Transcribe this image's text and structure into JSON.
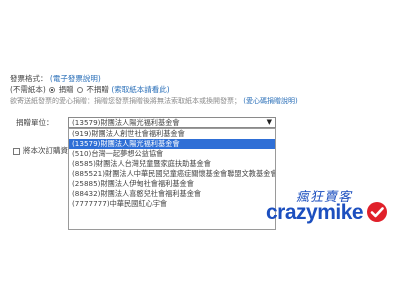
{
  "invoice": {
    "format_label": "發票格式：",
    "format_link": "(電子發票說明)",
    "no_mail_label": "(不需紙本)",
    "donate_label": "捐贈",
    "no_donate_label": "不捐贈",
    "donate_info_link": "(索取紙本請看此)",
    "notice_text": "欲寄送紙發票的愛心捐贈：捐贈您發票捐贈後將無法索取紙本或換開發票；",
    "notice_link": "(愛心碼捐贈說明)",
    "unit_label": "捐贈單位：",
    "selected_value": "(13579)財團法人陽光福利基金會",
    "options": [
      "(919)財團法人創世社會福利基金會",
      "(13579)財團法人陽光福利基金會",
      "(510)台灣一起夢想公益協會",
      "(8585)財團法人台灣兒童暨家庭扶助基金會",
      "(885521)財團法人中華民國兒童癌症關懷基金會聯盟文教基金會",
      "(25885)財團法人伊甸社會福利基金會",
      "(88432)財團法人喜憨兒社會福利基金會",
      "(7777777)中華民國紅心宇會"
    ],
    "selected_index": 1,
    "checkbox_label": "將本次訂購資"
  },
  "watermark": {
    "top_text": "瘋狂賣客",
    "main_text": "crazymike"
  },
  "colors": {
    "link": "#2a6fb8",
    "selection": "#2f6fd6",
    "brand_blue": "#1c4fbf",
    "brand_red": "#e0202a"
  }
}
